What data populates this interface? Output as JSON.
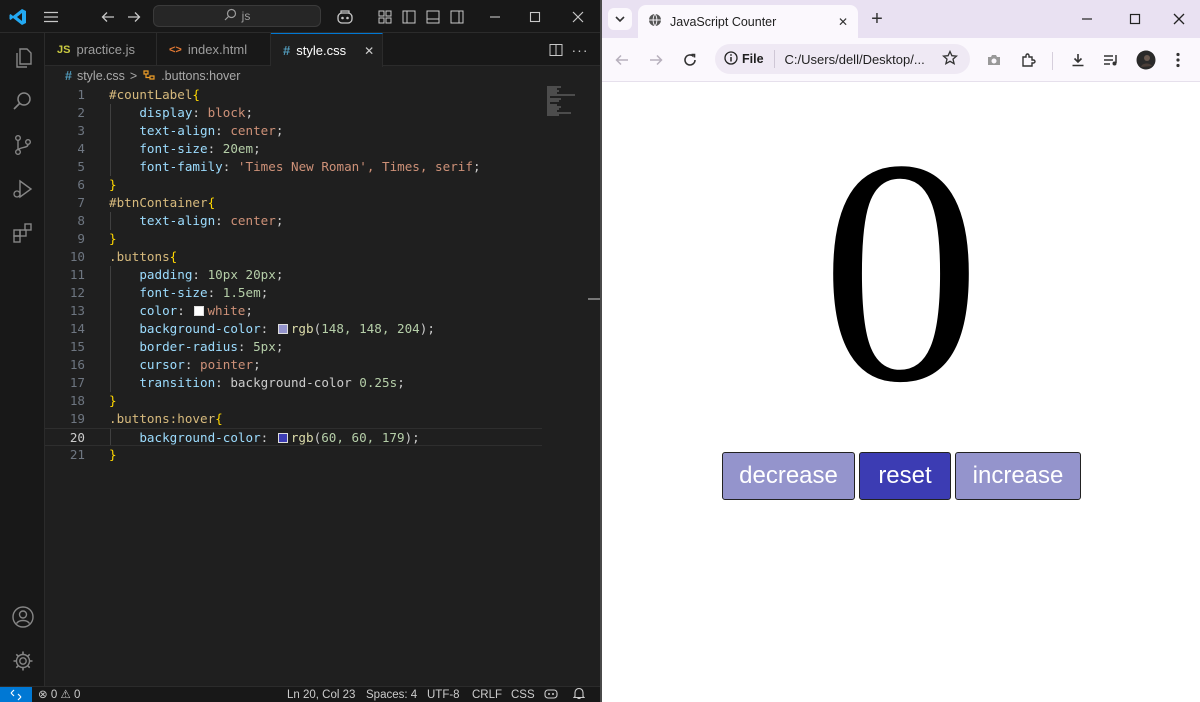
{
  "vscode": {
    "search": {
      "text": "js"
    },
    "tabs": [
      {
        "label": "practice.js",
        "icon_text": "JS",
        "icon_color": "#cbcb41"
      },
      {
        "label": "index.html",
        "icon_text": "<>",
        "icon_color": "#e37933"
      },
      {
        "label": "style.css",
        "icon_text": "#",
        "icon_color": "#519aba",
        "active": true,
        "close_glyph": "✕"
      }
    ],
    "breadcrumb": {
      "file": "style.css",
      "separator": ">",
      "symbol": ".buttons:hover"
    },
    "code_lines": [
      {
        "n": "1"
      },
      {
        "n": "2"
      },
      {
        "n": "3"
      },
      {
        "n": "4"
      },
      {
        "n": "5"
      },
      {
        "n": "6"
      },
      {
        "n": "7"
      },
      {
        "n": "8"
      },
      {
        "n": "9"
      },
      {
        "n": "10"
      },
      {
        "n": "11"
      },
      {
        "n": "12"
      },
      {
        "n": "13"
      },
      {
        "n": "14"
      },
      {
        "n": "15"
      },
      {
        "n": "16"
      },
      {
        "n": "17"
      },
      {
        "n": "18"
      },
      {
        "n": "19"
      },
      {
        "n": "20"
      },
      {
        "n": "21"
      }
    ],
    "code": {
      "l1_sel": "#countLabel",
      "l1_br": "{",
      "l2_prop": "display",
      "l2_val": "block",
      "l3_prop": "text-align",
      "l3_val": "center",
      "l4_prop": "font-size",
      "l4_val": "20em",
      "l5_prop": "font-family",
      "l5_val": "'Times New Roman', Times, serif",
      "l6_br": "}",
      "l7_sel": "#btnContainer",
      "l7_br": "{",
      "l8_prop": "text-align",
      "l8_val": "center",
      "l9_br": "}",
      "l10_sel": ".buttons",
      "l10_br": "{",
      "l11_prop": "padding",
      "l11_val": "10px 20px",
      "l12_prop": "font-size",
      "l12_val": "1.5em",
      "l13_prop": "color",
      "l13_val": "white",
      "l13_swatch": "#ffffff",
      "l14_prop": "background-color",
      "l14_fn": "rgb",
      "l14_args": "148, 148, 204",
      "l14_swatch": "#9494cc",
      "l15_prop": "border-radius",
      "l15_val": "5px",
      "l16_prop": "cursor",
      "l16_val": "pointer",
      "l17_prop": "transition",
      "l17_val1": "background-color",
      "l17_val2": "0.25s",
      "l18_br": "}",
      "l19_sel": ".buttons:hover",
      "l19_br": "{",
      "l20_prop": "background-color",
      "l20_fn": "rgb",
      "l20_args": "60, 60, 179",
      "l20_swatch": "#3c3cb3",
      "l21_br": "}"
    },
    "current_line": "20",
    "status": {
      "errors": "0",
      "warnings": "0",
      "position": "Ln 20, Col 23",
      "spaces": "Spaces: 4",
      "encoding": "UTF-8",
      "eol": "CRLF",
      "language": "CSS"
    }
  },
  "browser": {
    "tab_title": "JavaScript Counter",
    "tab_close_glyph": "✕",
    "new_tab_glyph": "+",
    "omnibox": {
      "scheme": "File",
      "url": "C:/Users/dell/Desktop/..."
    },
    "page": {
      "count": "0",
      "buttons": [
        {
          "label": "decrease",
          "color": "#9494cc"
        },
        {
          "label": "reset",
          "color": "#3c3cb3",
          "state": "hover"
        },
        {
          "label": "increase",
          "color": "#9494cc"
        }
      ]
    }
  },
  "icons": {
    "vscode-logo": "vscode-logo-icon",
    "menu": "hamburger-icon",
    "back": "arrow-left-icon",
    "forward": "arrow-right-icon",
    "search": "search-icon",
    "copilot": "copilot-icon",
    "explorer": "files-icon",
    "source-control": "git-branch-icon",
    "run-debug": "run-debug-icon",
    "extensions": "extensions-icon",
    "accounts": "account-icon",
    "settings": "gear-icon"
  }
}
